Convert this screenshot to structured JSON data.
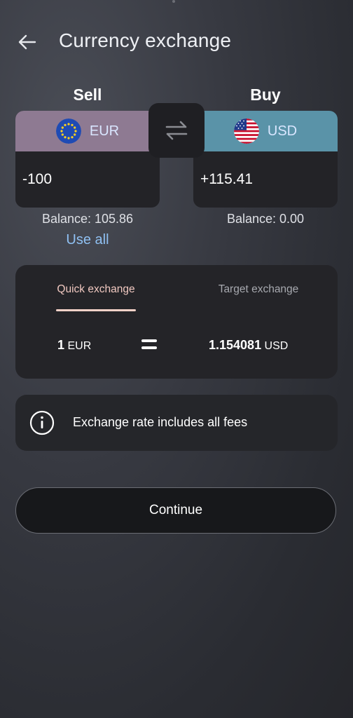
{
  "header": {
    "title": "Currency exchange",
    "back_icon": "arrow-left-icon"
  },
  "sell": {
    "label": "Sell",
    "currency_code": "EUR",
    "flag_icon": "eu-flag-icon",
    "amount": "-100",
    "balance": "Balance: 105.86",
    "use_all": "Use all",
    "head_color": "#8e7a92"
  },
  "buy": {
    "label": "Buy",
    "currency_code": "USD",
    "flag_icon": "us-flag-icon",
    "amount": "+115.41",
    "balance": "Balance: 0.00",
    "head_color": "#5a93a8"
  },
  "swap": {
    "icon": "swap-arrows-icon"
  },
  "exchange_mode": {
    "tabs": [
      {
        "label": "Quick exchange",
        "active": true
      },
      {
        "label": "Target exchange",
        "active": false
      }
    ],
    "rate": {
      "from_amount": "1",
      "from_code": "EUR",
      "equals": "=",
      "to_amount": "1.154081",
      "to_code": "USD"
    }
  },
  "info": {
    "icon": "info-circle-icon",
    "text": "Exchange rate includes all fees"
  },
  "actions": {
    "continue_label": "Continue"
  },
  "colors": {
    "accent_tab": "#f4d2c8",
    "link": "#8fc0f2",
    "panel": "#242428"
  }
}
